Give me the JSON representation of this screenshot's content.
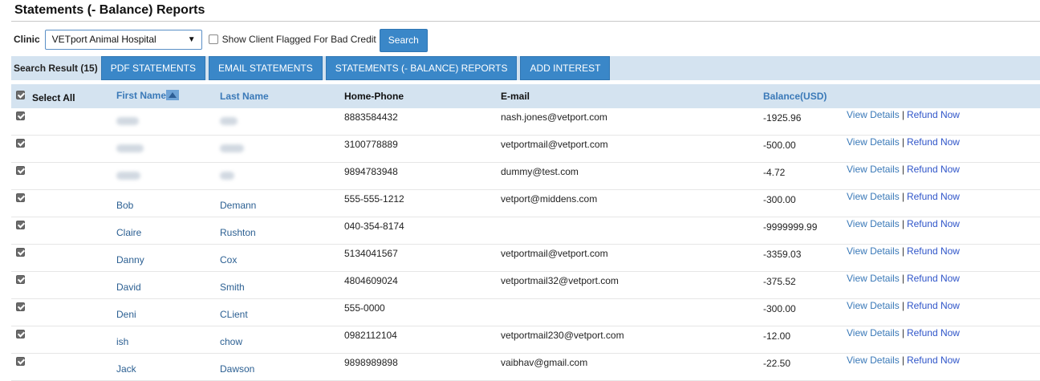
{
  "page": {
    "title": "Statements (- Balance) Reports"
  },
  "filters": {
    "clinic_label": "Clinic",
    "clinic_value": "VETport Animal Hospital",
    "flag_label": "Show Client Flagged For Bad Credit",
    "search_label": "Search"
  },
  "toolbar": {
    "result_label": "Search Result (15)",
    "buttons": [
      "PDF STATEMENTS",
      "EMAIL STATEMENTS",
      "STATEMENTS (- BALANCE) REPORTS",
      "ADD INTEREST"
    ]
  },
  "table": {
    "headers": {
      "select_all": "Select All",
      "first_name": "First Name",
      "last_name": "Last Name",
      "home_phone": "Home-Phone",
      "email": "E-mail",
      "balance": "Balance(USD)"
    },
    "action_view": "View Details",
    "action_sep": "|",
    "action_refund": "Refund Now",
    "rows": [
      {
        "first": "",
        "last": "",
        "phone": "8883584432",
        "email": "nash.jones@vetport.com",
        "balance": "-1925.96"
      },
      {
        "first": "",
        "last": "",
        "phone": "3100778889",
        "email": "vetportmail@vetport.com",
        "balance": "-500.00"
      },
      {
        "first": "",
        "last": "",
        "phone": "9894783948",
        "email": "dummy@test.com",
        "balance": "-4.72"
      },
      {
        "first": "Bob",
        "last": "Demann",
        "phone": "555-555-1212",
        "email": "vetport@middens.com",
        "balance": "-300.00"
      },
      {
        "first": "Claire",
        "last": "Rushton",
        "phone": "040-354-8174",
        "email": "",
        "balance": "-9999999.99"
      },
      {
        "first": "Danny",
        "last": "Cox",
        "phone": "5134041567",
        "email": "vetportmail@vetport.com",
        "balance": "-3359.03"
      },
      {
        "first": "David",
        "last": "Smith",
        "phone": "4804609024",
        "email": "vetportmail32@vetport.com",
        "balance": "-375.52"
      },
      {
        "first": "Deni",
        "last": "CLient",
        "phone": "555-0000",
        "email": "",
        "balance": "-300.00"
      },
      {
        "first": "ish",
        "last": "chow",
        "phone": "0982112104",
        "email": "vetportmail230@vetport.com",
        "balance": "-12.00"
      },
      {
        "first": "Jack",
        "last": "Dawson",
        "phone": "9898989898",
        "email": "vaibhav@gmail.com",
        "balance": "-22.50"
      }
    ]
  }
}
